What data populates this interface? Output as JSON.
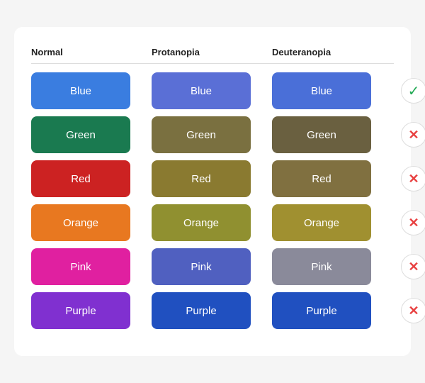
{
  "headers": {
    "normal": "Normal",
    "protanopia": "Protanopia",
    "deuteranopia": "Deuteranopia"
  },
  "rows": [
    {
      "label": "Blue",
      "normal_color": "#3a7de0",
      "protanopia_color": "#5a6fd6",
      "deuteranopia_color": "#4a6fd8",
      "status": "check",
      "status_symbol": "✓"
    },
    {
      "label": "Green",
      "normal_color": "#1a7a50",
      "protanopia_color": "#7a7040",
      "deuteranopia_color": "#6a6040",
      "status": "cross",
      "status_symbol": "✕"
    },
    {
      "label": "Red",
      "normal_color": "#cc2222",
      "protanopia_color": "#8a7a30",
      "deuteranopia_color": "#807040",
      "status": "cross",
      "status_symbol": "✕"
    },
    {
      "label": "Orange",
      "normal_color": "#e87820",
      "protanopia_color": "#909030",
      "deuteranopia_color": "#a09030",
      "status": "cross",
      "status_symbol": "✕"
    },
    {
      "label": "Pink",
      "normal_color": "#e020a0",
      "protanopia_color": "#5060c0",
      "deuteranopia_color": "#8a8a9a",
      "status": "cross",
      "status_symbol": "✕"
    },
    {
      "label": "Purple",
      "normal_color": "#8030d0",
      "protanopia_color": "#2050c0",
      "deuteranopia_color": "#2050c0",
      "status": "cross",
      "status_symbol": "✕"
    }
  ]
}
